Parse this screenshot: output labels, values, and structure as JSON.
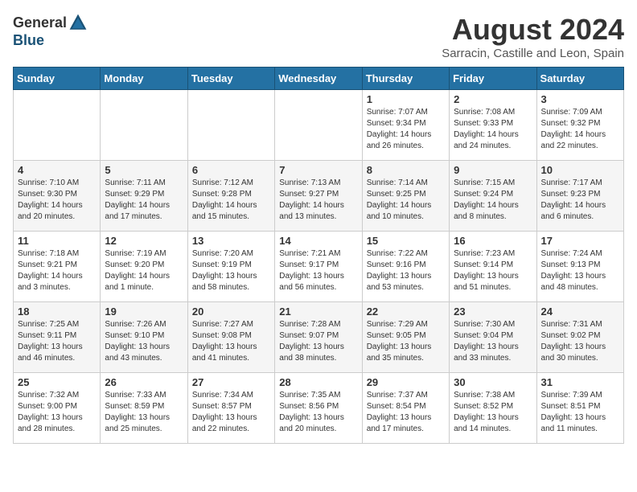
{
  "logo": {
    "general": "General",
    "blue": "Blue"
  },
  "header": {
    "month": "August 2024",
    "location": "Sarracin, Castille and Leon, Spain"
  },
  "weekdays": [
    "Sunday",
    "Monday",
    "Tuesday",
    "Wednesday",
    "Thursday",
    "Friday",
    "Saturday"
  ],
  "weeks": [
    [
      {
        "day": "",
        "sunrise": "",
        "sunset": "",
        "daylight": ""
      },
      {
        "day": "",
        "sunrise": "",
        "sunset": "",
        "daylight": ""
      },
      {
        "day": "",
        "sunrise": "",
        "sunset": "",
        "daylight": ""
      },
      {
        "day": "",
        "sunrise": "",
        "sunset": "",
        "daylight": ""
      },
      {
        "day": "1",
        "sunrise": "Sunrise: 7:07 AM",
        "sunset": "Sunset: 9:34 PM",
        "daylight": "Daylight: 14 hours and 26 minutes."
      },
      {
        "day": "2",
        "sunrise": "Sunrise: 7:08 AM",
        "sunset": "Sunset: 9:33 PM",
        "daylight": "Daylight: 14 hours and 24 minutes."
      },
      {
        "day": "3",
        "sunrise": "Sunrise: 7:09 AM",
        "sunset": "Sunset: 9:32 PM",
        "daylight": "Daylight: 14 hours and 22 minutes."
      }
    ],
    [
      {
        "day": "4",
        "sunrise": "Sunrise: 7:10 AM",
        "sunset": "Sunset: 9:30 PM",
        "daylight": "Daylight: 14 hours and 20 minutes."
      },
      {
        "day": "5",
        "sunrise": "Sunrise: 7:11 AM",
        "sunset": "Sunset: 9:29 PM",
        "daylight": "Daylight: 14 hours and 17 minutes."
      },
      {
        "day": "6",
        "sunrise": "Sunrise: 7:12 AM",
        "sunset": "Sunset: 9:28 PM",
        "daylight": "Daylight: 14 hours and 15 minutes."
      },
      {
        "day": "7",
        "sunrise": "Sunrise: 7:13 AM",
        "sunset": "Sunset: 9:27 PM",
        "daylight": "Daylight: 14 hours and 13 minutes."
      },
      {
        "day": "8",
        "sunrise": "Sunrise: 7:14 AM",
        "sunset": "Sunset: 9:25 PM",
        "daylight": "Daylight: 14 hours and 10 minutes."
      },
      {
        "day": "9",
        "sunrise": "Sunrise: 7:15 AM",
        "sunset": "Sunset: 9:24 PM",
        "daylight": "Daylight: 14 hours and 8 minutes."
      },
      {
        "day": "10",
        "sunrise": "Sunrise: 7:17 AM",
        "sunset": "Sunset: 9:23 PM",
        "daylight": "Daylight: 14 hours and 6 minutes."
      }
    ],
    [
      {
        "day": "11",
        "sunrise": "Sunrise: 7:18 AM",
        "sunset": "Sunset: 9:21 PM",
        "daylight": "Daylight: 14 hours and 3 minutes."
      },
      {
        "day": "12",
        "sunrise": "Sunrise: 7:19 AM",
        "sunset": "Sunset: 9:20 PM",
        "daylight": "Daylight: 14 hours and 1 minute."
      },
      {
        "day": "13",
        "sunrise": "Sunrise: 7:20 AM",
        "sunset": "Sunset: 9:19 PM",
        "daylight": "Daylight: 13 hours and 58 minutes."
      },
      {
        "day": "14",
        "sunrise": "Sunrise: 7:21 AM",
        "sunset": "Sunset: 9:17 PM",
        "daylight": "Daylight: 13 hours and 56 minutes."
      },
      {
        "day": "15",
        "sunrise": "Sunrise: 7:22 AM",
        "sunset": "Sunset: 9:16 PM",
        "daylight": "Daylight: 13 hours and 53 minutes."
      },
      {
        "day": "16",
        "sunrise": "Sunrise: 7:23 AM",
        "sunset": "Sunset: 9:14 PM",
        "daylight": "Daylight: 13 hours and 51 minutes."
      },
      {
        "day": "17",
        "sunrise": "Sunrise: 7:24 AM",
        "sunset": "Sunset: 9:13 PM",
        "daylight": "Daylight: 13 hours and 48 minutes."
      }
    ],
    [
      {
        "day": "18",
        "sunrise": "Sunrise: 7:25 AM",
        "sunset": "Sunset: 9:11 PM",
        "daylight": "Daylight: 13 hours and 46 minutes."
      },
      {
        "day": "19",
        "sunrise": "Sunrise: 7:26 AM",
        "sunset": "Sunset: 9:10 PM",
        "daylight": "Daylight: 13 hours and 43 minutes."
      },
      {
        "day": "20",
        "sunrise": "Sunrise: 7:27 AM",
        "sunset": "Sunset: 9:08 PM",
        "daylight": "Daylight: 13 hours and 41 minutes."
      },
      {
        "day": "21",
        "sunrise": "Sunrise: 7:28 AM",
        "sunset": "Sunset: 9:07 PM",
        "daylight": "Daylight: 13 hours and 38 minutes."
      },
      {
        "day": "22",
        "sunrise": "Sunrise: 7:29 AM",
        "sunset": "Sunset: 9:05 PM",
        "daylight": "Daylight: 13 hours and 35 minutes."
      },
      {
        "day": "23",
        "sunrise": "Sunrise: 7:30 AM",
        "sunset": "Sunset: 9:04 PM",
        "daylight": "Daylight: 13 hours and 33 minutes."
      },
      {
        "day": "24",
        "sunrise": "Sunrise: 7:31 AM",
        "sunset": "Sunset: 9:02 PM",
        "daylight": "Daylight: 13 hours and 30 minutes."
      }
    ],
    [
      {
        "day": "25",
        "sunrise": "Sunrise: 7:32 AM",
        "sunset": "Sunset: 9:00 PM",
        "daylight": "Daylight: 13 hours and 28 minutes."
      },
      {
        "day": "26",
        "sunrise": "Sunrise: 7:33 AM",
        "sunset": "Sunset: 8:59 PM",
        "daylight": "Daylight: 13 hours and 25 minutes."
      },
      {
        "day": "27",
        "sunrise": "Sunrise: 7:34 AM",
        "sunset": "Sunset: 8:57 PM",
        "daylight": "Daylight: 13 hours and 22 minutes."
      },
      {
        "day": "28",
        "sunrise": "Sunrise: 7:35 AM",
        "sunset": "Sunset: 8:56 PM",
        "daylight": "Daylight: 13 hours and 20 minutes."
      },
      {
        "day": "29",
        "sunrise": "Sunrise: 7:37 AM",
        "sunset": "Sunset: 8:54 PM",
        "daylight": "Daylight: 13 hours and 17 minutes."
      },
      {
        "day": "30",
        "sunrise": "Sunrise: 7:38 AM",
        "sunset": "Sunset: 8:52 PM",
        "daylight": "Daylight: 13 hours and 14 minutes."
      },
      {
        "day": "31",
        "sunrise": "Sunrise: 7:39 AM",
        "sunset": "Sunset: 8:51 PM",
        "daylight": "Daylight: 13 hours and 11 minutes."
      }
    ]
  ]
}
